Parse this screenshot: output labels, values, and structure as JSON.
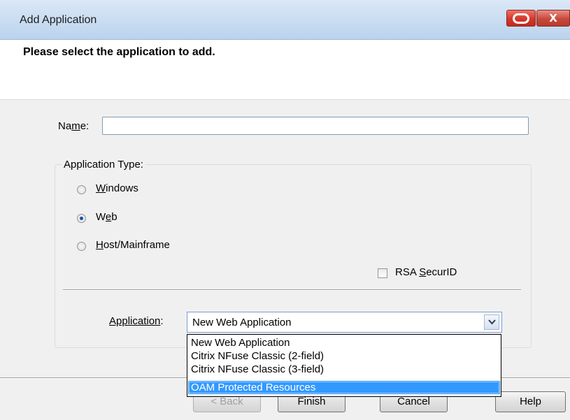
{
  "window": {
    "title": "Add Application",
    "close_glyph": "X",
    "oracle_icon": "oracle-ring-icon"
  },
  "header": {
    "prompt": "Please select the application to add."
  },
  "form": {
    "name_label": "Name:",
    "name_value": "",
    "group_label": "Application Type:",
    "radios": [
      {
        "label": "Windows",
        "checked": false
      },
      {
        "label": "Web",
        "checked": true
      },
      {
        "label": "Host/Mainframe",
        "checked": false
      }
    ],
    "rsa_label": "RSA SecurID",
    "rsa_checked": false,
    "application_label": "Application:",
    "application_value": "New Web Application",
    "application_options": [
      "New Web Application",
      "Citrix NFuse Classic (2-field)",
      "Citrix NFuse Classic (3-field)",
      "OAM Protected Resources"
    ],
    "highlighted_option": "OAM Protected Resources"
  },
  "buttons": {
    "back": "< Back",
    "finish": "Finish",
    "cancel": "Cancel",
    "help": "Help"
  },
  "colors": {
    "selection": "#3399ff",
    "title_gradient_top": "#dbe8f7",
    "close_button": "#c8493c"
  }
}
